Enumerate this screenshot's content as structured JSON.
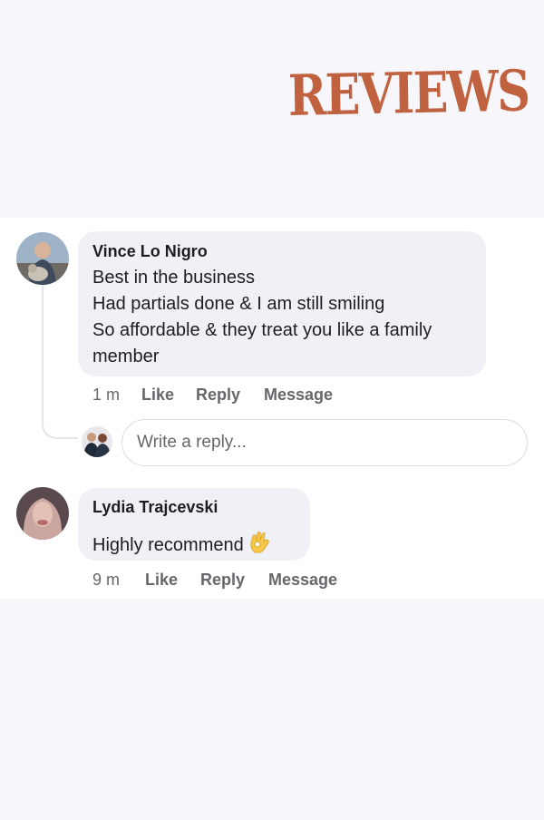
{
  "header": {
    "title": "REVIEWS",
    "title_color": "#c0623f"
  },
  "comments": [
    {
      "author": "Vince Lo Nigro",
      "lines": [
        "Best in the business",
        "Had partials done & I am still smiling",
        "So affordable & they treat you like a family",
        "member"
      ],
      "time": "1 m",
      "actions": [
        "Like",
        "Reply",
        "Message"
      ]
    },
    {
      "author": "Lydia Trajcevski",
      "lines": [
        "Highly recommend"
      ],
      "emoji": "ok-hand-emoji",
      "time": "9 m",
      "actions": [
        "Like",
        "Reply",
        "Message"
      ]
    }
  ],
  "reply": {
    "placeholder": "Write a reply..."
  },
  "colors": {
    "background": "#f7f7fb",
    "bubble": "#f0f1f6",
    "meta_text": "#65676b"
  }
}
